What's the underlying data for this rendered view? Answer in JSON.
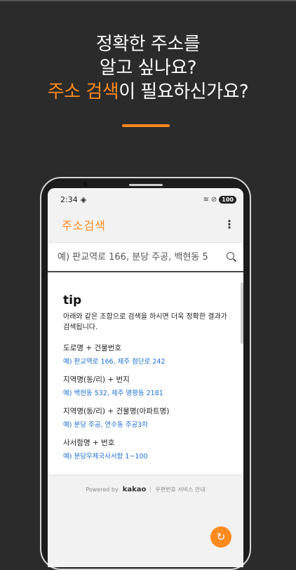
{
  "hero": {
    "line1": "정확한 주소를",
    "line2": "알고 싶나요?",
    "line3_accent": "주소 검색",
    "line3_rest": "이 필요하신가요?"
  },
  "status": {
    "time": "2:34",
    "battery": "100"
  },
  "app": {
    "title": "주소검색"
  },
  "search": {
    "placeholder": "예) 판교역로 166, 분당 주공, 백현동 5"
  },
  "tip": {
    "title": "tip",
    "description": "아래와 같은 조합으로 검색을 하시면 더욱 정확한 결과가 검색됩니다.",
    "examples": [
      {
        "label": "도로명 + 건물번호",
        "value": "예) 판교역로 166,  제주 첨단로 242"
      },
      {
        "label": "지역명(동/리) + 번지",
        "value": "예) 백현동 532,  제주 영평동 2181"
      },
      {
        "label": "지역명(동/리) + 건물명(아파트명)",
        "value": "예) 분당 주공,  연수동 주공3차"
      },
      {
        "label": "사서함명 + 번호",
        "value": "예) 분당우체국사서함 1~100"
      }
    ]
  },
  "footer": {
    "powered_by": "Powered by",
    "brand": "kakao",
    "service_info": "우편번호 서비스 안내"
  },
  "colors": {
    "accent": "#ff8a1e",
    "link": "#1a6fd4",
    "background": "#2b2b2b"
  }
}
